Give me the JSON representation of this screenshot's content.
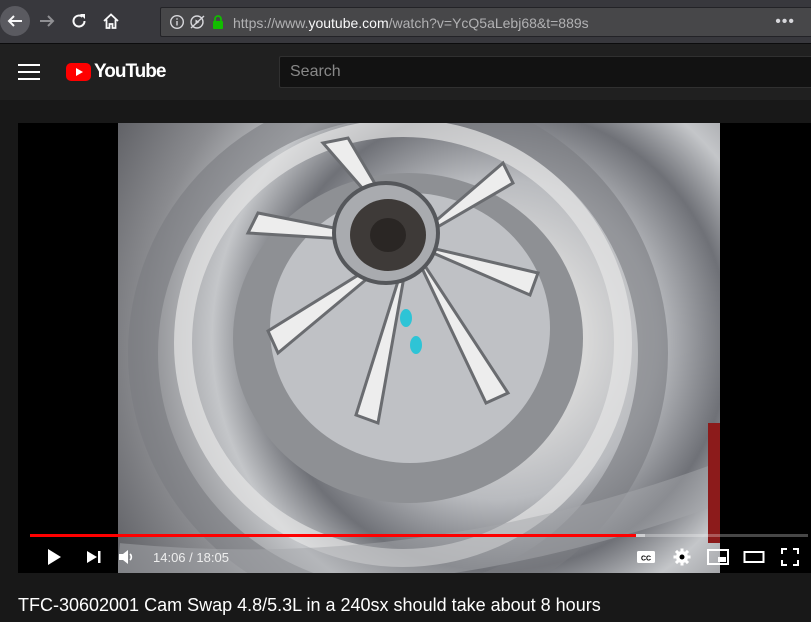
{
  "browser": {
    "url_prefix": "https://www.",
    "url_domain": "youtube.com",
    "url_suffix": "/watch?v=YcQ5aLebj68&t=889s",
    "page_actions": "•••"
  },
  "header": {
    "logo_text": "YouTube",
    "search_placeholder": "Search"
  },
  "player": {
    "time_current": "14:06",
    "time_separator": " / ",
    "time_total": "18:05",
    "progress_fraction": 0.779,
    "loaded_fraction": 0.79,
    "accent_color": "#ff0000"
  },
  "video": {
    "title": "TFC-30602001 Cam Swap 4.8/5.3L in a 240sx should take about 8 hours"
  },
  "icons": [
    "back-icon",
    "forward-icon",
    "reload-icon",
    "home-icon",
    "info-icon",
    "autoplay-blocked-icon",
    "lock-icon",
    "menu-icon",
    "play-icon",
    "next-icon",
    "volume-icon",
    "captions-icon",
    "settings-icon",
    "miniplayer-icon",
    "theater-icon",
    "fullscreen-icon"
  ]
}
